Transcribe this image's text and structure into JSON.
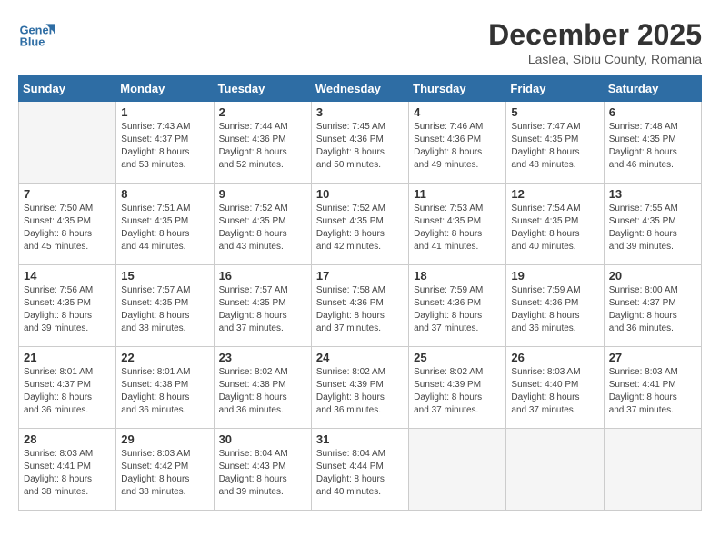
{
  "logo": {
    "line1": "General",
    "line2": "Blue"
  },
  "title": "December 2025",
  "location": "Laslea, Sibiu County, Romania",
  "weekdays": [
    "Sunday",
    "Monday",
    "Tuesday",
    "Wednesday",
    "Thursday",
    "Friday",
    "Saturday"
  ],
  "days": [
    {
      "date": "",
      "info": ""
    },
    {
      "date": "1",
      "info": "Sunrise: 7:43 AM\nSunset: 4:37 PM\nDaylight: 8 hours\nand 53 minutes."
    },
    {
      "date": "2",
      "info": "Sunrise: 7:44 AM\nSunset: 4:36 PM\nDaylight: 8 hours\nand 52 minutes."
    },
    {
      "date": "3",
      "info": "Sunrise: 7:45 AM\nSunset: 4:36 PM\nDaylight: 8 hours\nand 50 minutes."
    },
    {
      "date": "4",
      "info": "Sunrise: 7:46 AM\nSunset: 4:36 PM\nDaylight: 8 hours\nand 49 minutes."
    },
    {
      "date": "5",
      "info": "Sunrise: 7:47 AM\nSunset: 4:35 PM\nDaylight: 8 hours\nand 48 minutes."
    },
    {
      "date": "6",
      "info": "Sunrise: 7:48 AM\nSunset: 4:35 PM\nDaylight: 8 hours\nand 46 minutes."
    },
    {
      "date": "7",
      "info": "Sunrise: 7:50 AM\nSunset: 4:35 PM\nDaylight: 8 hours\nand 45 minutes."
    },
    {
      "date": "8",
      "info": "Sunrise: 7:51 AM\nSunset: 4:35 PM\nDaylight: 8 hours\nand 44 minutes."
    },
    {
      "date": "9",
      "info": "Sunrise: 7:52 AM\nSunset: 4:35 PM\nDaylight: 8 hours\nand 43 minutes."
    },
    {
      "date": "10",
      "info": "Sunrise: 7:52 AM\nSunset: 4:35 PM\nDaylight: 8 hours\nand 42 minutes."
    },
    {
      "date": "11",
      "info": "Sunrise: 7:53 AM\nSunset: 4:35 PM\nDaylight: 8 hours\nand 41 minutes."
    },
    {
      "date": "12",
      "info": "Sunrise: 7:54 AM\nSunset: 4:35 PM\nDaylight: 8 hours\nand 40 minutes."
    },
    {
      "date": "13",
      "info": "Sunrise: 7:55 AM\nSunset: 4:35 PM\nDaylight: 8 hours\nand 39 minutes."
    },
    {
      "date": "14",
      "info": "Sunrise: 7:56 AM\nSunset: 4:35 PM\nDaylight: 8 hours\nand 39 minutes."
    },
    {
      "date": "15",
      "info": "Sunrise: 7:57 AM\nSunset: 4:35 PM\nDaylight: 8 hours\nand 38 minutes."
    },
    {
      "date": "16",
      "info": "Sunrise: 7:57 AM\nSunset: 4:35 PM\nDaylight: 8 hours\nand 37 minutes."
    },
    {
      "date": "17",
      "info": "Sunrise: 7:58 AM\nSunset: 4:36 PM\nDaylight: 8 hours\nand 37 minutes."
    },
    {
      "date": "18",
      "info": "Sunrise: 7:59 AM\nSunset: 4:36 PM\nDaylight: 8 hours\nand 37 minutes."
    },
    {
      "date": "19",
      "info": "Sunrise: 7:59 AM\nSunset: 4:36 PM\nDaylight: 8 hours\nand 36 minutes."
    },
    {
      "date": "20",
      "info": "Sunrise: 8:00 AM\nSunset: 4:37 PM\nDaylight: 8 hours\nand 36 minutes."
    },
    {
      "date": "21",
      "info": "Sunrise: 8:01 AM\nSunset: 4:37 PM\nDaylight: 8 hours\nand 36 minutes."
    },
    {
      "date": "22",
      "info": "Sunrise: 8:01 AM\nSunset: 4:38 PM\nDaylight: 8 hours\nand 36 minutes."
    },
    {
      "date": "23",
      "info": "Sunrise: 8:02 AM\nSunset: 4:38 PM\nDaylight: 8 hours\nand 36 minutes."
    },
    {
      "date": "24",
      "info": "Sunrise: 8:02 AM\nSunset: 4:39 PM\nDaylight: 8 hours\nand 36 minutes."
    },
    {
      "date": "25",
      "info": "Sunrise: 8:02 AM\nSunset: 4:39 PM\nDaylight: 8 hours\nand 37 minutes."
    },
    {
      "date": "26",
      "info": "Sunrise: 8:03 AM\nSunset: 4:40 PM\nDaylight: 8 hours\nand 37 minutes."
    },
    {
      "date": "27",
      "info": "Sunrise: 8:03 AM\nSunset: 4:41 PM\nDaylight: 8 hours\nand 37 minutes."
    },
    {
      "date": "28",
      "info": "Sunrise: 8:03 AM\nSunset: 4:41 PM\nDaylight: 8 hours\nand 38 minutes."
    },
    {
      "date": "29",
      "info": "Sunrise: 8:03 AM\nSunset: 4:42 PM\nDaylight: 8 hours\nand 38 minutes."
    },
    {
      "date": "30",
      "info": "Sunrise: 8:04 AM\nSunset: 4:43 PM\nDaylight: 8 hours\nand 39 minutes."
    },
    {
      "date": "31",
      "info": "Sunrise: 8:04 AM\nSunset: 4:44 PM\nDaylight: 8 hours\nand 40 minutes."
    },
    {
      "date": "",
      "info": ""
    },
    {
      "date": "",
      "info": ""
    },
    {
      "date": "",
      "info": ""
    },
    {
      "date": "",
      "info": ""
    }
  ]
}
